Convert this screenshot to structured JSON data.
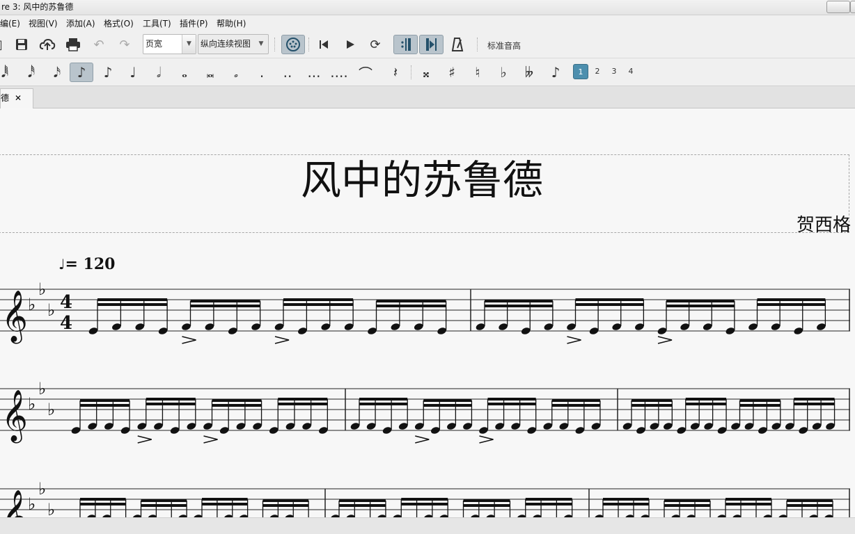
{
  "window": {
    "title": "re 3: 风中的苏鲁德"
  },
  "menu": [
    "编(E)",
    "视图(V)",
    "添加(A)",
    "格式(O)",
    "工具(T)",
    "插件(P)",
    "帮助(H)"
  ],
  "toolbar": {
    "zoom_value": "页宽",
    "view_mode_value": "纵向连续视图",
    "concert_pitch_label": "标准音高"
  },
  "voices": [
    "1",
    "2",
    "3",
    "4"
  ],
  "tab": {
    "label": "德",
    "close": "✕"
  },
  "score": {
    "title": "风中的苏鲁德",
    "composer": "贺西格",
    "tempo_text": "= 120",
    "time_signature": "4/4",
    "key_signature": "3 flats"
  },
  "colors": {
    "accent": "#4d8fae",
    "active_button": "#b9c4cc",
    "page_bg": "#f7f7f7"
  }
}
